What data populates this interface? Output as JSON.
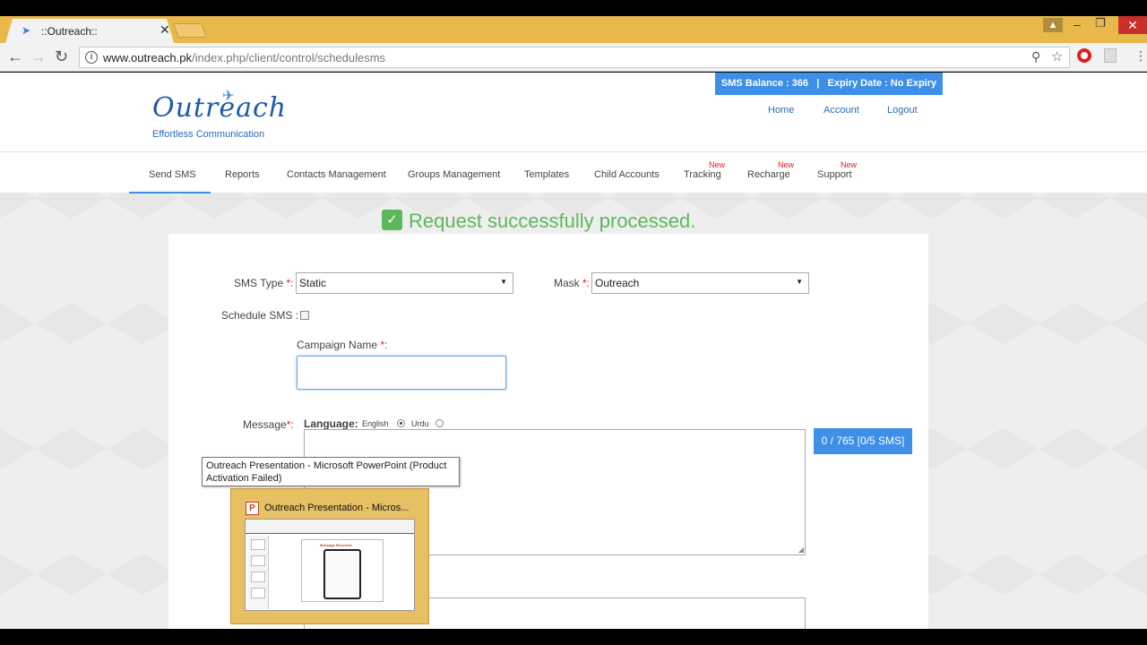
{
  "browser": {
    "tab_title": "::Outreach::",
    "tab_close": "✕",
    "url_host": "www.outreach.pk",
    "url_path": "/index.php/client/control/schedulesms"
  },
  "header": {
    "logo_text": "Outreach",
    "logo_tagline": "Effortless Communication",
    "balance_text": "SMS Balance : 366   |   Expiry Date : No Expiry",
    "links": {
      "home": "Home",
      "account": "Account",
      "logout": "Logout"
    }
  },
  "nav": {
    "items": [
      {
        "label": "Send SMS",
        "new": ""
      },
      {
        "label": "Reports",
        "new": ""
      },
      {
        "label": "Contacts Management",
        "new": ""
      },
      {
        "label": "Groups Management",
        "new": ""
      },
      {
        "label": "Templates",
        "new": ""
      },
      {
        "label": "Child Accounts",
        "new": ""
      },
      {
        "label": "Tracking",
        "new": "New"
      },
      {
        "label": "Recharge",
        "new": "New"
      },
      {
        "label": "Support",
        "new": "New"
      }
    ]
  },
  "alert": {
    "message": "Request successfully processed."
  },
  "form": {
    "sms_type_label": "SMS Type ",
    "sms_type_value": "Static",
    "mask_label": "Mask ",
    "mask_value": "Outreach",
    "required_mark": "*:",
    "schedule_label": "Schedule SMS :",
    "campaign_label": "Campaign Name ",
    "campaign_required": "*:",
    "message_label": "Message",
    "message_required": "*:",
    "language_label": "Language:",
    "lang_english": "English",
    "lang_urdu": "Urdu",
    "counter": "0 / 765 [0/5 SMS]"
  },
  "taskbar_popup": {
    "tooltip": "Outreach Presentation - Microsoft PowerPoint (Product Activation Failed)",
    "preview_title": "Outreach Presentation - Micros...",
    "app_icon_letter": "P",
    "slide_title": "Message Received"
  },
  "colors": {
    "accent": "#3d8fe8",
    "success": "#5cb85c",
    "required": "#e02020",
    "chrome_frame": "#e8b84a"
  }
}
